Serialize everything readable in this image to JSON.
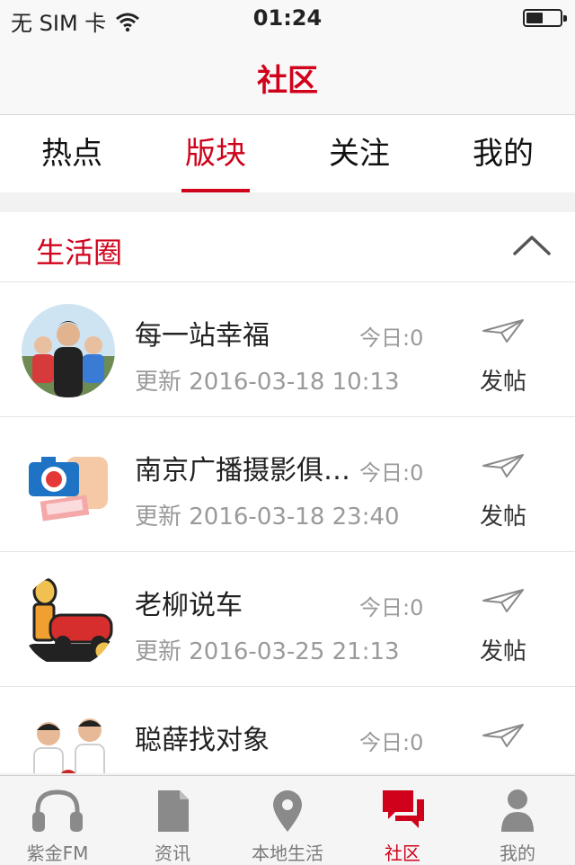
{
  "status_bar": {
    "carrier": "无 SIM 卡",
    "time": "01:24",
    "battery_level": 0.5
  },
  "nav": {
    "title": "社区"
  },
  "tabs": [
    {
      "label": "热点",
      "active": false
    },
    {
      "label": "版块",
      "active": true
    },
    {
      "label": "关注",
      "active": false
    },
    {
      "label": "我的",
      "active": false
    }
  ],
  "section": {
    "title": "生活圈",
    "icon": "chevron-up-icon"
  },
  "rows": [
    {
      "title": "每一站幸福",
      "today": "今日:0",
      "updated": "更新 2016-03-18 10:13",
      "post_label": "发帖"
    },
    {
      "title": "南京广播摄影俱乐部",
      "today": "今日:0",
      "updated": "更新 2016-03-18 23:40",
      "post_label": "发帖"
    },
    {
      "title": "老柳说车",
      "today": "今日:0",
      "updated": "更新 2016-03-25 21:13",
      "post_label": "发帖"
    },
    {
      "title": "聪薛找对象",
      "today": "今日:0",
      "updated": "",
      "post_label": ""
    }
  ],
  "tab_bar": [
    {
      "label": "紫金FM",
      "icon": "headphones-icon",
      "active": false
    },
    {
      "label": "资讯",
      "icon": "document-icon",
      "active": false
    },
    {
      "label": "本地生活",
      "icon": "location-pin-icon",
      "active": false
    },
    {
      "label": "社区",
      "icon": "chat-bubbles-icon",
      "active": true
    },
    {
      "label": "我的",
      "icon": "person-icon",
      "active": false
    }
  ],
  "colors": {
    "accent": "#d0021b",
    "muted_text": "#9a9a9a",
    "tab_icon": "#8a8a8a"
  }
}
